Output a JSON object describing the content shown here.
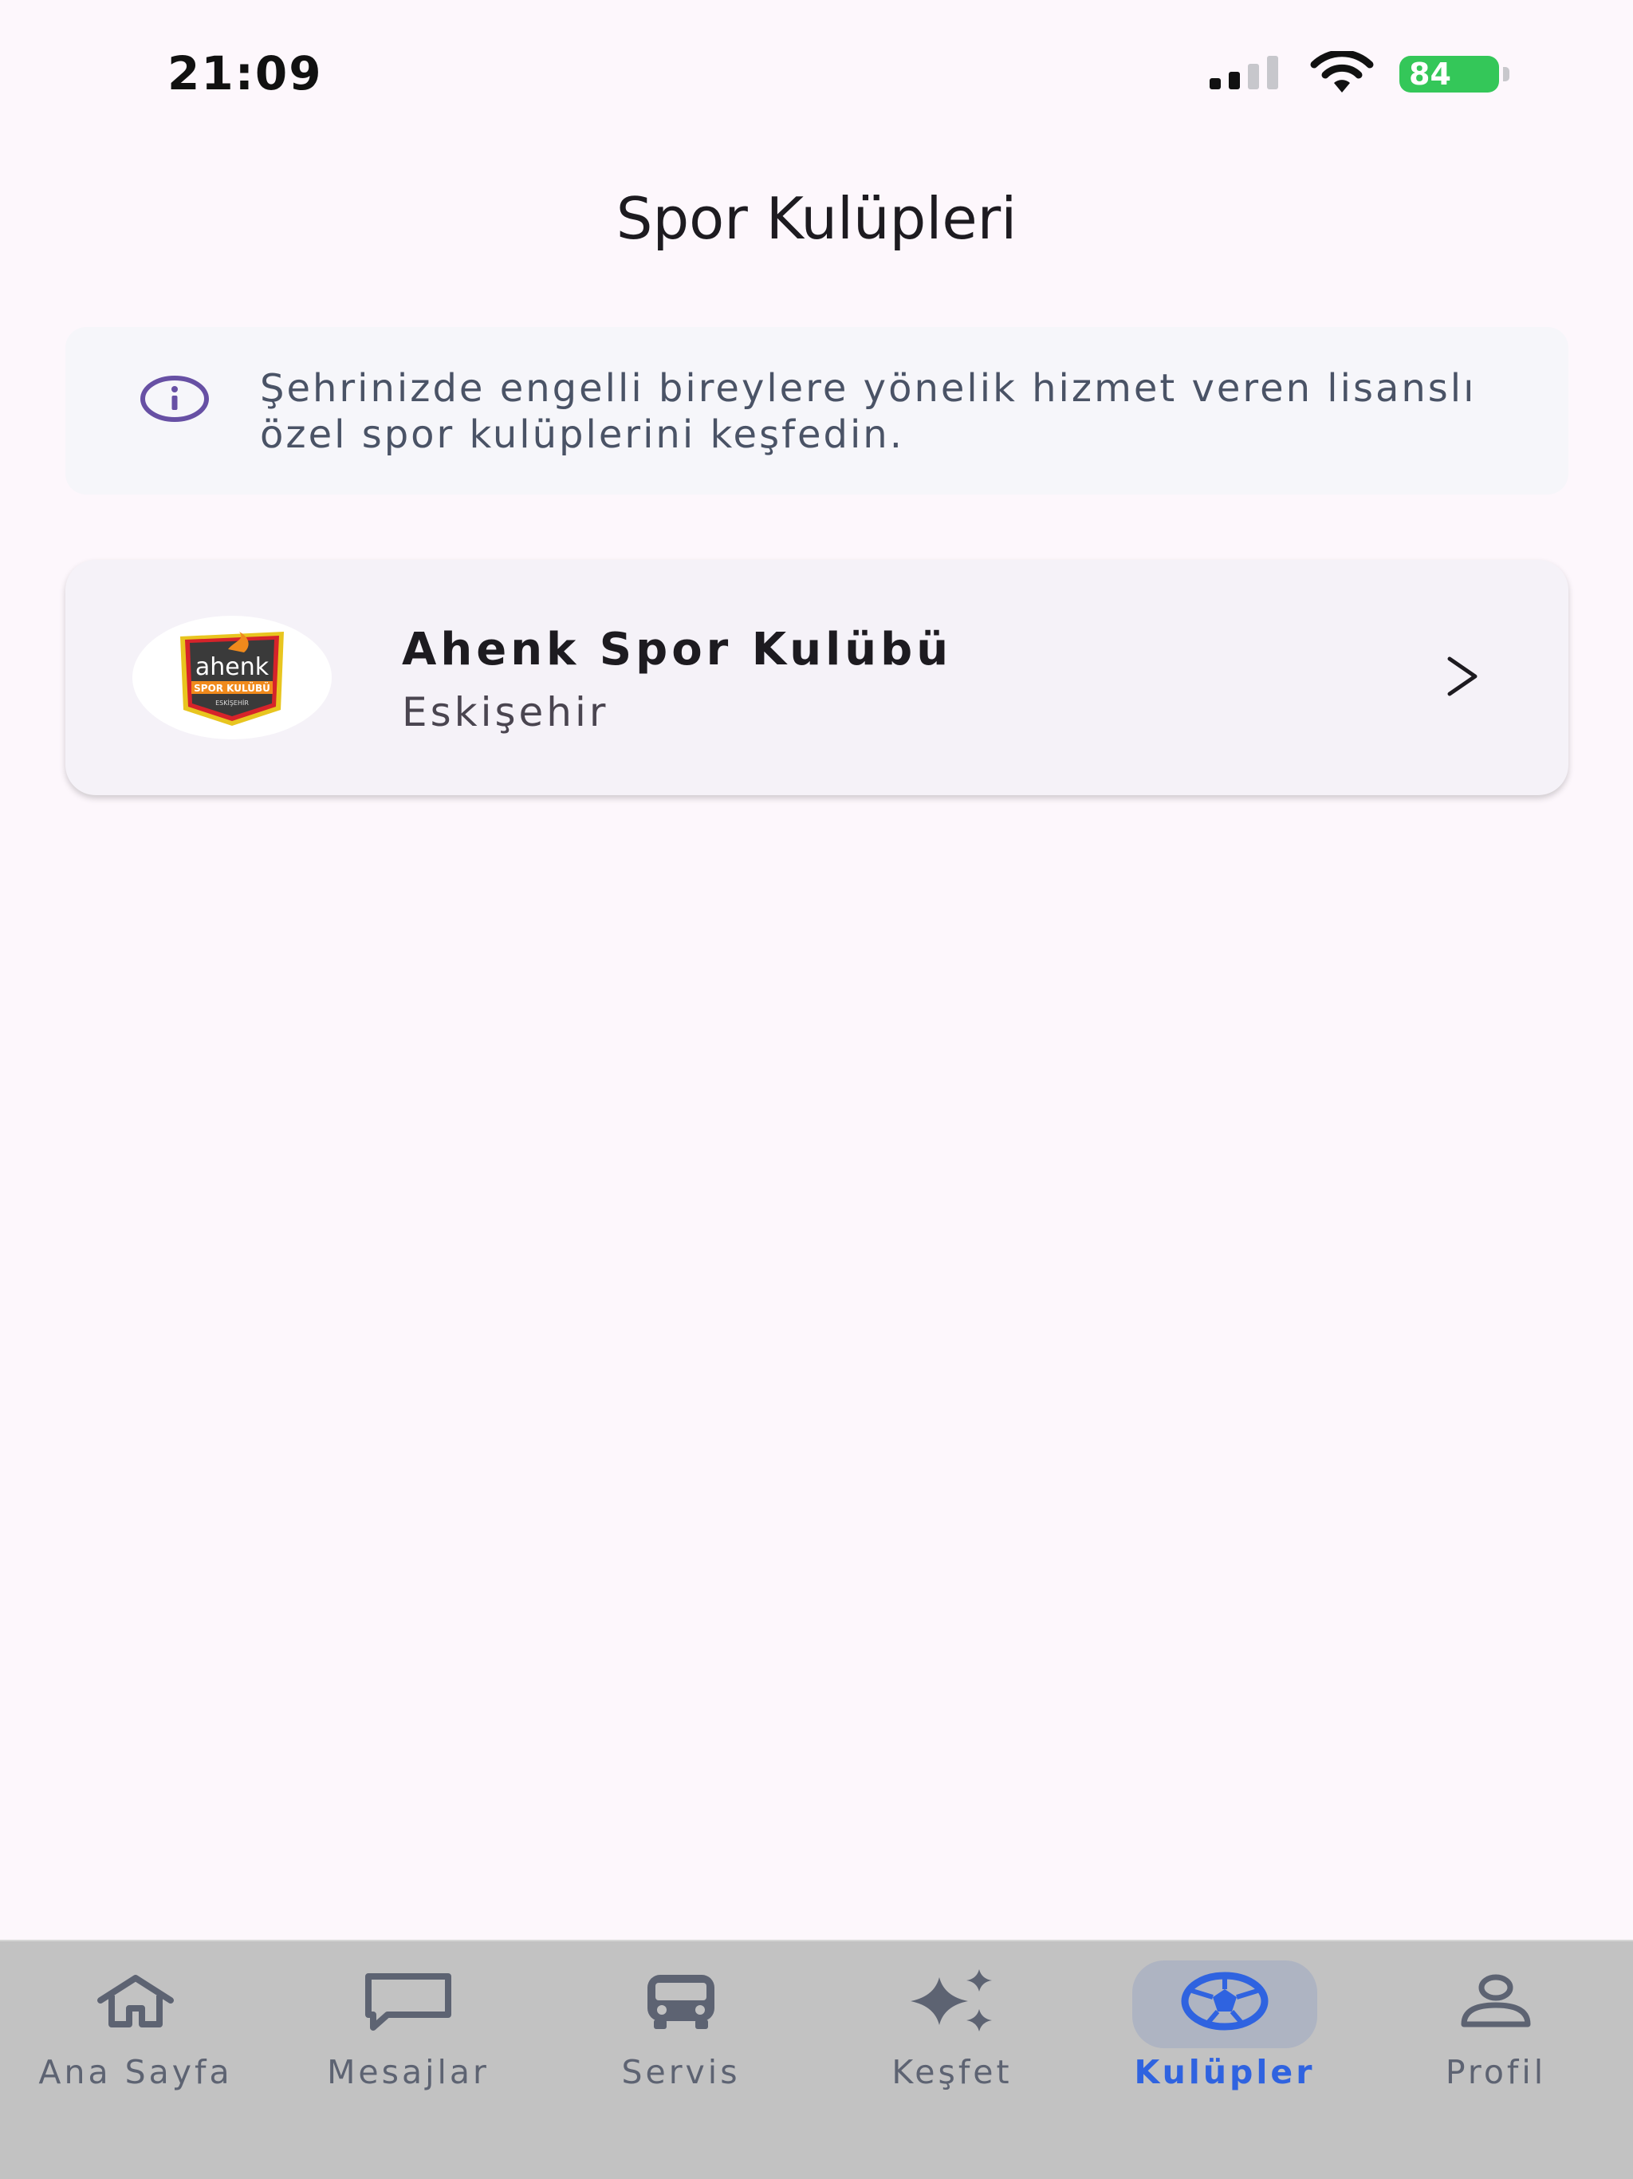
{
  "status_bar": {
    "time": "21:09",
    "battery": "84"
  },
  "header": {
    "title": "Spor Kulüpleri"
  },
  "info_banner": {
    "icon": "info-icon",
    "text": "Şehrinizde engelli bireylere yönelik hizmet veren lisanslı özel spor kulüplerini keşfedin."
  },
  "clubs": [
    {
      "name": "Ahenk Spor Kulübü",
      "city": "Eskişehir",
      "logo": {
        "word": "ahenk",
        "banner": "SPOR KULÜBÜ",
        "footer": "ESKİŞEHİR"
      }
    }
  ],
  "bottom_nav": {
    "active": "Kulüpler",
    "items": [
      {
        "label": "Ana Sayfa",
        "icon": "home-icon"
      },
      {
        "label": "Mesajlar",
        "icon": "message-icon"
      },
      {
        "label": "Servis",
        "icon": "bus-icon"
      },
      {
        "label": "Keşfet",
        "icon": "sparkle-icon"
      },
      {
        "label": "Kulüpler",
        "icon": "soccer-ball-icon"
      },
      {
        "label": "Profil",
        "icon": "person-icon"
      }
    ]
  },
  "colors": {
    "background": "#fdf7fc",
    "accent": "#2f63e0",
    "info_icon": "#6750a4",
    "battery": "#34c759",
    "nav_background": "#c2c2c2"
  }
}
